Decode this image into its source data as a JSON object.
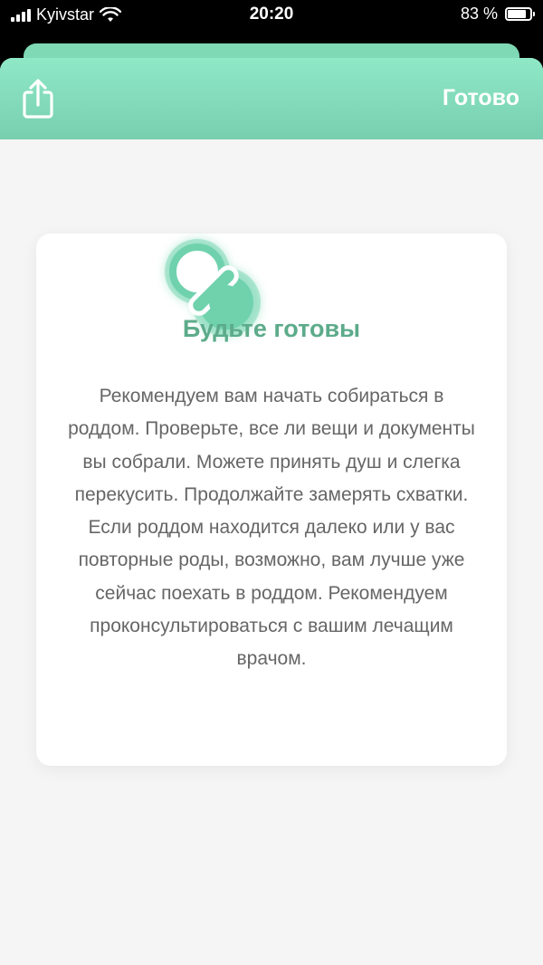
{
  "status_bar": {
    "carrier": "Kyivstar",
    "time": "20:20",
    "battery_percent_text": "83 %",
    "battery_level": 0.83,
    "icons": [
      "signal-icon",
      "wifi-icon",
      "battery-icon"
    ]
  },
  "header": {
    "share_icon": "share-icon",
    "done_label": "Готово"
  },
  "card": {
    "icon": "pacifier-icon",
    "title": "Будьте готовы",
    "body": "Рекомендуем вам начать собираться в роддом. Проверьте, все ли вещи и документы вы собрали. Можете принять душ и слегка перекусить. Продолжайте замерять схватки. Если роддом находится далеко или у вас повторные роды, возможно, вам лучше уже сейчас поехать в роддом. Рекомендуем проконсультироваться с вашим лечащим врачом."
  },
  "colors": {
    "accent": "#77cfb0",
    "title": "#5cab8a",
    "background": "#f5f5f5"
  }
}
